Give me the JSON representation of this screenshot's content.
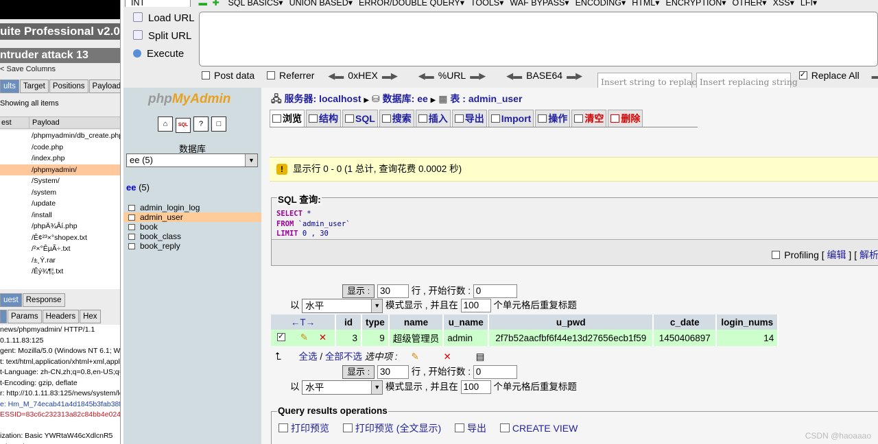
{
  "burp": {
    "suite_title": "uite Professional v2.0b",
    "intruder_title": "ntruder attack 13",
    "menu": "< Save  Columns",
    "tabs": [
      "ults",
      "Target",
      "Positions",
      "Payloads",
      "c"
    ],
    "showing": "Showing all items",
    "col_request": "est",
    "col_payload": "Payload",
    "payloads": [
      "/phpmyadmin/db_create.php",
      "/code.php",
      "/index.php",
      "/phpmyadmin/",
      "/System/",
      "/system",
      "/update",
      "/install",
      "/phpÄ¾Âí.php",
      "/Ê¢²³×°shopex.txt",
      "/²×°ÊµÃ÷.txt",
      "/±¸Ý.rar",
      "/Êý¾¶¦.txt"
    ],
    "selected_payload": 3,
    "req_tabs": [
      "uest",
      "Response"
    ],
    "sub_tabs": [
      "",
      "Params",
      "Headers",
      "Hex"
    ],
    "request_lines": [
      {
        "t": "news/phpmyadmin/ HTTP/1.1",
        "c": ""
      },
      {
        "t": "0.1.11.83:125",
        "c": ""
      },
      {
        "t": "gent: Mozilla/5.0 (Windows NT 6.1; WO",
        "c": ""
      },
      {
        "t": "t: text/html,application/xhtml+xml,applic",
        "c": ""
      },
      {
        "t": "t-Language: zh-CN,zh;q=0.8,en-US;q=0",
        "c": ""
      },
      {
        "t": "t-Encoding: gzip, deflate",
        "c": ""
      },
      {
        "t": "r: http://10.1.11.83:125/news/system/lo",
        "c": ""
      },
      {
        "t": "e: Hm_M_74ecab41a4d1845b3fab38f",
        "c": "blue"
      },
      {
        "t": "ESSID=83c6c232313a82c84bb4e024",
        "c": "red"
      },
      {
        "t": "",
        "c": ""
      },
      {
        "t": "ization: Basic YWRtaW46cXdlcnR5",
        "c": ""
      },
      {
        "t": "ction: close",
        "c": ""
      }
    ]
  },
  "hackbar": {
    "select_value": "INT",
    "menu_items": [
      "SQL BASICS▾",
      "UNION BASED▾",
      "ERROR/DOUBLE QUERY▾",
      "TOOLS▾",
      "WAF BYPASS▾",
      "ENCODING▾",
      "HTML▾",
      "ENCRYPTION▾",
      "OTHER▾",
      "XSS▾",
      "LFI▾"
    ],
    "load_url": "Load URL",
    "split_url": "Split URL",
    "execute": "Execute",
    "post_data": "Post data",
    "referrer": "Referrer",
    "hex": "0xHEX",
    "url": "%URL",
    "base64": "BASE64",
    "replace_placeholder": "Insert string to replace",
    "replacing_placeholder": "Insert replacing string",
    "replace_all": "Replace All"
  },
  "pma_left": {
    "logo_a": "php",
    "logo_b": "MyAdmin",
    "icons": [
      "⌂",
      "SQL",
      "?",
      "□"
    ],
    "db_label": "数据库",
    "db_select": "ee (5)",
    "db_name": "ee",
    "db_count": "(5)",
    "tables": [
      "admin_login_log",
      "admin_user",
      "book",
      "book_class",
      "book_reply"
    ],
    "selected_table": 1
  },
  "pma_main": {
    "crumb_server": "服务器: localhost",
    "crumb_db": "数据库: ee",
    "crumb_table": "表 : admin_user",
    "tabs": [
      "浏览",
      "结构",
      "SQL",
      "搜索",
      "插入",
      "导出",
      "Import",
      "操作",
      "清空",
      "删除"
    ],
    "notice": "显示行 0 - 0 (1 总计, 查询花费 0.0002 秒)",
    "sql_legend": "SQL 查询:",
    "sql_select": "SELECT",
    "sql_star": " *",
    "sql_from": "FROM",
    "sql_table": " `admin_user`",
    "sql_limit": "LIMIT",
    "sql_limit_val": " 0 , 30",
    "profiling": "Profiling",
    "edit": "编辑",
    "explain": "解析",
    "display_btn": "显示 :",
    "rows_value": "30",
    "rows_text": "行 , 开始行数 :",
    "start_value": "0",
    "mode_prefix": "以",
    "mode_value": "水平",
    "mode_text": "模式显示 , 并且在",
    "repeat_value": "100",
    "repeat_text": "个单元格后重复标题",
    "columns": [
      "id",
      "type",
      "name",
      "u_name",
      "u_pwd",
      "c_date",
      "login_nums"
    ],
    "row": [
      "3",
      "9",
      "超级管理员",
      "admin",
      "2f7b52aacfbf6f44e13d27656ecb1f59",
      "1450406897",
      "14"
    ],
    "select_all": "全选",
    "deselect_all": "全部不选",
    "selected_items": "选中项 :",
    "qro_legend": "Query results operations",
    "ops": [
      "打印预览",
      "打印预览 (全文显示)",
      "导出",
      "CREATE VIEW"
    ]
  },
  "watermark": "CSDN @haoaaao"
}
